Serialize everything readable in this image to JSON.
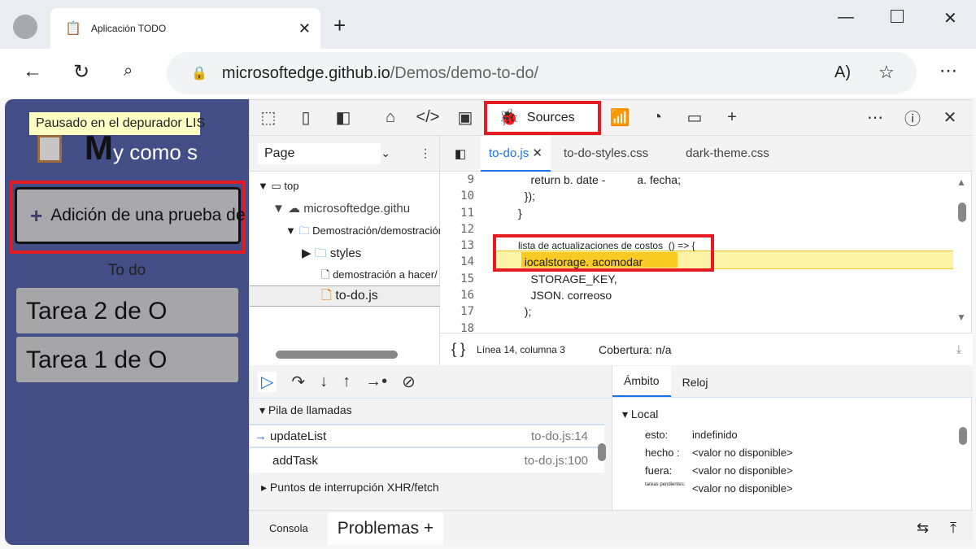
{
  "browser": {
    "tab_title": "Aplicación TODO",
    "url_host": "microsoftedge.github.io",
    "url_path": "/Demos/demo-to-do/"
  },
  "app": {
    "paused_banner": "Pausado en el depurador LIS",
    "title_big": "M",
    "title_rest": "y como s",
    "add_button": "Adición de una prueba de tarea",
    "section": "To do",
    "tasks": [
      "Tarea 2 de O",
      "Tarea 1 de O"
    ]
  },
  "devtools": {
    "sources_tab": "Sources",
    "navigator": {
      "dropdown": "Page",
      "items": [
        "top",
        "microsoftedge.githu",
        "Demostración/demostración a(",
        "styles",
        "demostración a hacer/",
        "to-do.js"
      ]
    },
    "editor_tabs": [
      "to-do.js",
      "to-do-styles.css",
      "dark-theme.css"
    ],
    "line_numbers": [
      "9",
      "10",
      "11",
      "12",
      "13",
      "14",
      "15",
      "16",
      "17",
      "18"
    ],
    "code": [
      "    return b. date -          a. fecha;",
      "  });",
      "}",
      "",
      "lista de actualizaciones de costos  () => {",
      "  iocalstorage. acomodar",
      "    STORAGE_KEY,",
      "    JSON. correoso",
      "  );",
      ""
    ],
    "status": {
      "position": "Línea 14, columna 3",
      "coverage": "Cobertura: n/a",
      "braces": "{ }"
    },
    "callstack": {
      "header": "Pila de llamadas",
      "frames": [
        {
          "name": "updateList",
          "loc": "to-do.js:14"
        },
        {
          "name": "addTask",
          "loc": "to-do.js:100"
        }
      ],
      "xhr": "Puntos de interrupción XHR/fetch"
    },
    "scope": {
      "tabs": [
        "Ámbito",
        "Reloj"
      ],
      "local": "Local",
      "vars": [
        {
          "k": "esto:",
          "v": "indefinido"
        },
        {
          "k": "hecho :",
          "v": "<valor no disponible>"
        },
        {
          "k": "fuera:",
          "v": "<valor no disponible>"
        },
        {
          "k": "tareas pendientes:",
          "v": "<valor no disponible>"
        }
      ]
    },
    "drawer": {
      "console": "Consola",
      "issues": "Problemas +"
    }
  }
}
